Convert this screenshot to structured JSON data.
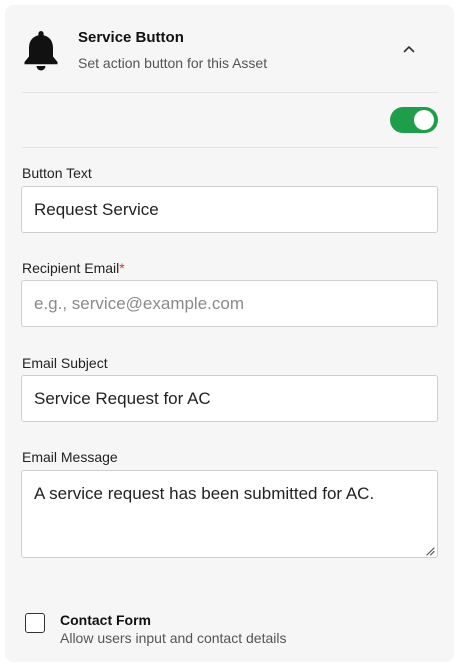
{
  "header": {
    "title": "Service Button",
    "subtitle": "Set action button for this Asset",
    "icon": "bell-icon",
    "collapse_icon": "chevron-up-icon"
  },
  "toggle": {
    "enabled": true,
    "color": "#1e9e4b"
  },
  "fields": {
    "button_text": {
      "label": "Button Text",
      "value": "Request Service"
    },
    "recipient_email": {
      "label": "Recipient Email",
      "required_mark": "*",
      "value": "",
      "placeholder": "e.g., service@example.com"
    },
    "email_subject": {
      "label": "Email Subject",
      "value": "Service Request for AC"
    },
    "email_message": {
      "label": "Email Message",
      "value": "A service request has been submitted for AC."
    }
  },
  "contact_form": {
    "checked": false,
    "title": "Contact Form",
    "subtitle": "Allow users input and contact details"
  }
}
